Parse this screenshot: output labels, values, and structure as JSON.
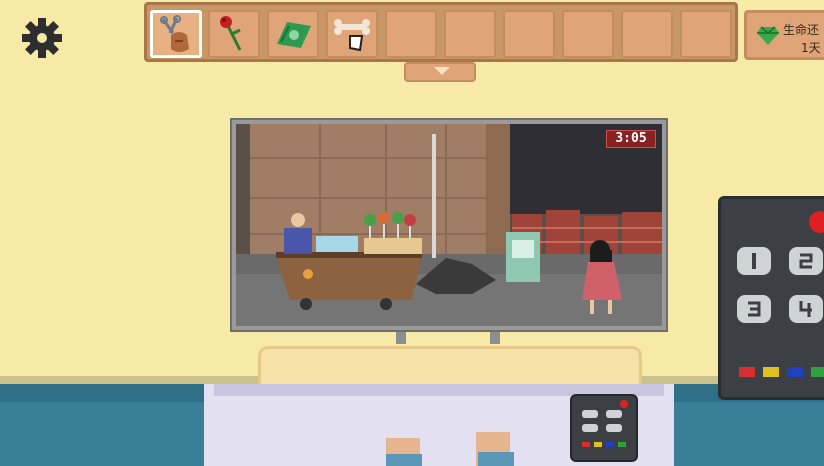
{
  "inventory": {
    "slots": [
      {
        "item": "scissors-and-bag-icon",
        "selected": true
      },
      {
        "item": "red-rose-icon",
        "selected": false
      },
      {
        "item": "cash-bill-icon",
        "selected": false
      },
      {
        "item": "bone-and-paper-icon",
        "selected": false
      },
      {
        "item": "",
        "selected": false
      },
      {
        "item": "",
        "selected": false
      },
      {
        "item": "",
        "selected": false
      },
      {
        "item": "",
        "selected": false
      },
      {
        "item": "",
        "selected": false
      },
      {
        "item": "",
        "selected": false
      }
    ],
    "toggle_icon": "chevron-down-icon"
  },
  "life": {
    "label": "生命还",
    "value": "1天",
    "icon": "green-gem-icon"
  },
  "tv": {
    "clock": "3:05"
  },
  "settings": {
    "icon": "gear-icon"
  },
  "colors": {
    "wall": "#f6eaa6",
    "floor": "#3a7f9a",
    "inventory": "#c99765",
    "clock_bg": "#8a2020",
    "remote": "#3c4044"
  }
}
